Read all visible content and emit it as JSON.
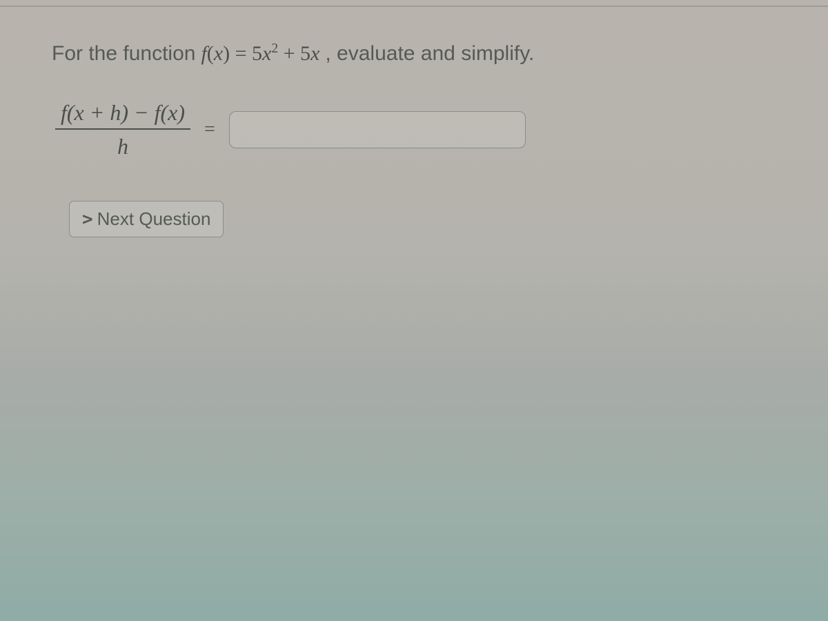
{
  "prompt": {
    "prefix": "For the function",
    "func_left": "f",
    "func_paren_open": "(",
    "func_var": "x",
    "func_paren_close": ")",
    "eq": " = ",
    "term_coeff1": "5",
    "term_var1": "x",
    "term_exp1": "2",
    "plus": " + ",
    "term_coeff2": "5",
    "term_var2": "x",
    "suffix": ", evaluate and simplify."
  },
  "difference_quotient": {
    "numerator": "f(x + h) − f(x)",
    "denominator": "h",
    "equals": "="
  },
  "answer_value": "",
  "next_button": {
    "chevron": ">",
    "label": "Next Question"
  }
}
